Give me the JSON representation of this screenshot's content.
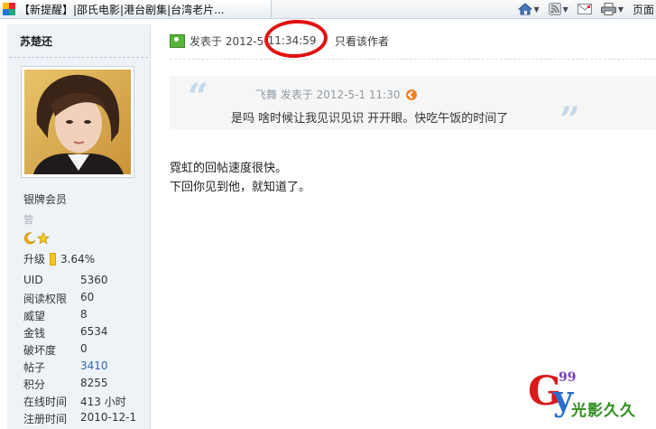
{
  "browser": {
    "tab_title": "【新提醒】|邵氏电影|港台剧集|台湾老片...",
    "toolbar": {
      "home_icon": "home-icon",
      "feed_icon": "rss-feed-icon",
      "mail_icon": "mail-icon",
      "print_icon": "printer-icon",
      "page_label": "页面"
    }
  },
  "profile": {
    "username": "苏楚还",
    "rank": "银牌会员",
    "rank_extra": "营",
    "level_up_label": "升级",
    "level_up_percent": "3.64%",
    "stats": [
      {
        "key": "UID",
        "value": "5360"
      },
      {
        "key": "阅读权限",
        "value": "60"
      },
      {
        "key": "威望",
        "value": "8"
      },
      {
        "key": "金钱",
        "value": "6534"
      },
      {
        "key": "破坏度",
        "value": "0"
      },
      {
        "key": "帖子",
        "value": "3410"
      },
      {
        "key": "积分",
        "value": "8255"
      },
      {
        "key": "在线时间",
        "value": "413 小时"
      },
      {
        "key": "注册时间",
        "value": "2010-12-1"
      }
    ]
  },
  "post": {
    "posted_prefix": "发表于 2012-5-",
    "posted_time": "11:34:59",
    "only_author": "只看该作者",
    "quote": {
      "header": "飞舞 发表于 2012-5-1 11:30",
      "body": "是吗 啥时候让我见识见识 开开眼。快吃午饭的时间了"
    },
    "content_lines": [
      "霓虹的回帖速度很快。",
      "下回你见到他，就知道了。"
    ]
  },
  "watermark": {
    "g": "G",
    "y": "y",
    "num": "99",
    "text": "光影久久"
  }
}
